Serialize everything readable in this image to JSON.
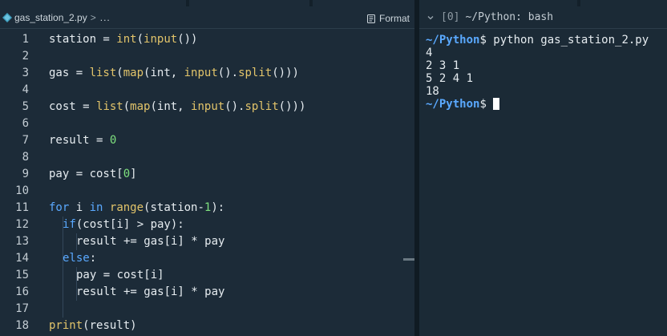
{
  "editor": {
    "breadcrumb": {
      "file": "gas_station_2.py",
      "separator": ">",
      "more": "..."
    },
    "format_label": "Format",
    "lines": [
      {
        "num": "1",
        "tokens": [
          [
            "",
            "station = "
          ],
          [
            "fn",
            "int"
          ],
          [
            "",
            "("
          ],
          [
            "fn",
            "input"
          ],
          [
            "",
            "())"
          ]
        ]
      },
      {
        "num": "2",
        "tokens": []
      },
      {
        "num": "3",
        "tokens": [
          [
            "",
            "gas = "
          ],
          [
            "fn",
            "list"
          ],
          [
            "",
            "("
          ],
          [
            "fn",
            "map"
          ],
          [
            "",
            "(int, "
          ],
          [
            "fn",
            "input"
          ],
          [
            "",
            "()."
          ],
          [
            "fn",
            "split"
          ],
          [
            "",
            "()))"
          ]
        ]
      },
      {
        "num": "4",
        "tokens": []
      },
      {
        "num": "5",
        "tokens": [
          [
            "",
            "cost = "
          ],
          [
            "fn",
            "list"
          ],
          [
            "",
            "("
          ],
          [
            "fn",
            "map"
          ],
          [
            "",
            "(int, "
          ],
          [
            "fn",
            "input"
          ],
          [
            "",
            "()."
          ],
          [
            "fn",
            "split"
          ],
          [
            "",
            "()))"
          ]
        ]
      },
      {
        "num": "6",
        "tokens": []
      },
      {
        "num": "7",
        "tokens": [
          [
            "",
            "result = "
          ],
          [
            "nm",
            "0"
          ]
        ]
      },
      {
        "num": "8",
        "tokens": []
      },
      {
        "num": "9",
        "tokens": [
          [
            "",
            "pay = cost["
          ],
          [
            "nm",
            "0"
          ],
          [
            "",
            "]"
          ]
        ]
      },
      {
        "num": "10",
        "tokens": []
      },
      {
        "num": "11",
        "tokens": [
          [
            "kw",
            "for"
          ],
          [
            "",
            " i "
          ],
          [
            "kw",
            "in"
          ],
          [
            "",
            " "
          ],
          [
            "fn",
            "range"
          ],
          [
            "",
            "(station-"
          ],
          [
            "nm",
            "1"
          ],
          [
            "",
            "):"
          ]
        ]
      },
      {
        "num": "12",
        "indent": 1,
        "tokens": [
          [
            "kw",
            "if"
          ],
          [
            "",
            "(cost[i] > pay):"
          ]
        ]
      },
      {
        "num": "13",
        "indent": 2,
        "tokens": [
          [
            "",
            "result += gas[i] * pay"
          ]
        ]
      },
      {
        "num": "14",
        "indent": 1,
        "tokens": [
          [
            "kw",
            "else"
          ],
          [
            "",
            ":"
          ]
        ]
      },
      {
        "num": "15",
        "indent": 2,
        "tokens": [
          [
            "",
            "pay = cost[i]"
          ]
        ]
      },
      {
        "num": "16",
        "indent": 2,
        "tokens": [
          [
            "",
            "result += gas[i] * pay"
          ]
        ]
      },
      {
        "num": "17",
        "indent": 1,
        "tokens": []
      },
      {
        "num": "18",
        "tokens": [
          [
            "fn",
            "print"
          ],
          [
            "",
            "(result)"
          ]
        ]
      }
    ]
  },
  "terminal": {
    "tab_index": "[0]",
    "tab_title": "~/Python: bash",
    "command_path": "~/Python",
    "command_dollar": "$",
    "command": " python gas_station_2.py",
    "output": [
      "4",
      "2 3 1",
      "5 2 4 1",
      "18"
    ],
    "prompt_path": "~/Python",
    "prompt_dollar": "$"
  },
  "colors": {
    "keyword": "#5aa9ff",
    "function": "#e2c46a",
    "number": "#7ee07e",
    "text": "#e6ecf0",
    "background": "#1c2b38"
  }
}
